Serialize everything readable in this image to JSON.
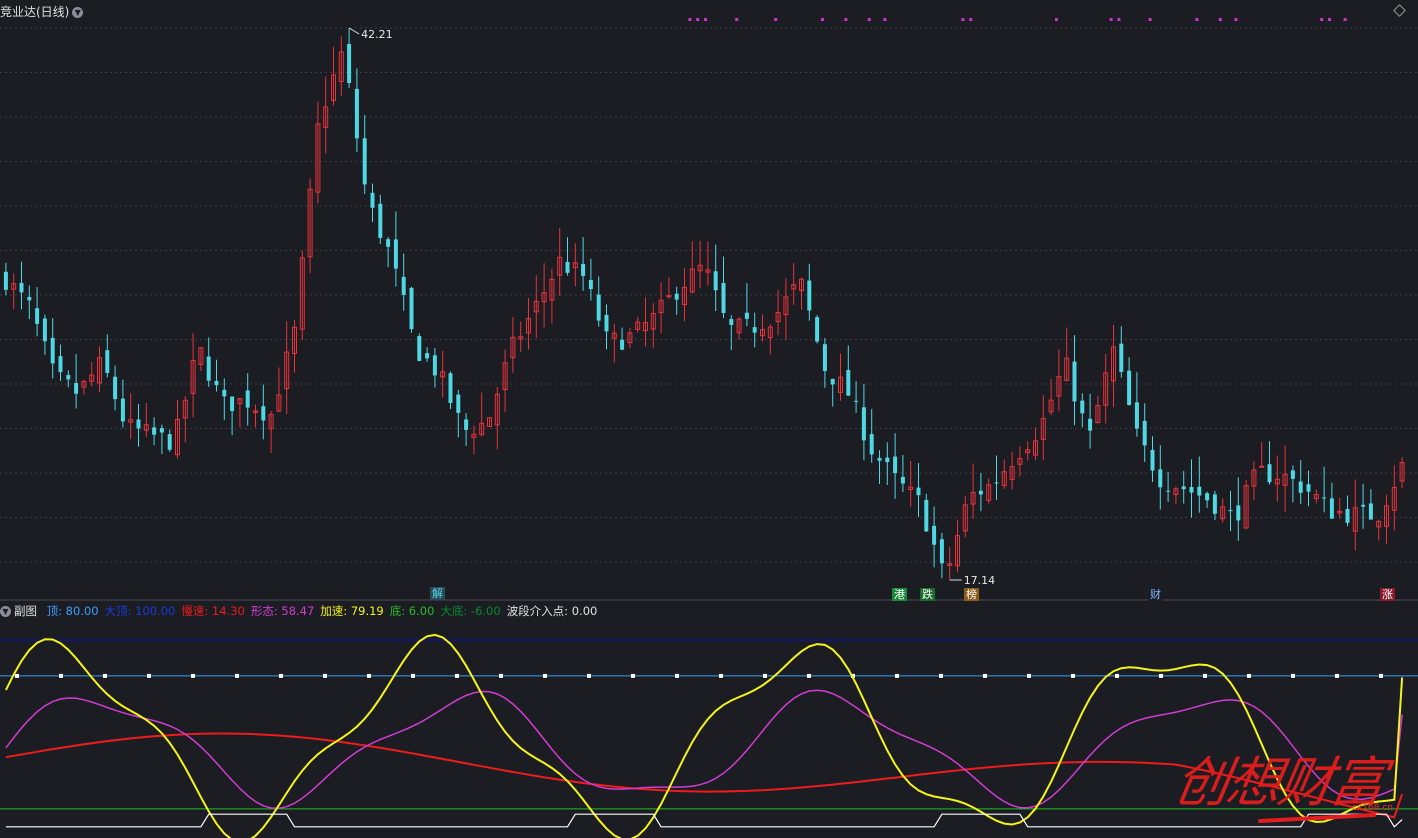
{
  "header": {
    "title": "竞业达(日线)",
    "expand_icon": "chevron-down-icon",
    "settings_icon": "diamond-icon"
  },
  "colors": {
    "bg": "#1b1d23",
    "candle_up": "#e8333a",
    "candle_down": "#4fd8e3",
    "grid": "#3a3d45",
    "top_line": "#3aa0ff",
    "extreme_top": "#1010c8",
    "slow": "#ee1c1c",
    "shape": "#d23cd2",
    "accel": "#f5f519",
    "bottom": "#22c022",
    "extreme_bottom": "#0a8a2a",
    "entry": "#ffffff",
    "marker": "#cc33cc"
  },
  "price_labels": {
    "high": "42.21",
    "low": "17.14"
  },
  "event_tags": [
    {
      "text": "解",
      "color": "#4fd8e3",
      "bg": "#2c4a55"
    },
    {
      "text": "港",
      "color": "#ffffff",
      "bg": "#1a8a3a"
    },
    {
      "text": "跌",
      "color": "#ffffff",
      "bg": "#1a6a2a"
    },
    {
      "text": "榜",
      "color": "#ffffff",
      "bg": "#8a5a1a"
    },
    {
      "text": "财",
      "color": "#7fb8ff",
      "bg": "#1b1d23"
    },
    {
      "text": "涨",
      "color": "#ffffff",
      "bg": "#8a1a2a"
    }
  ],
  "sub_indicator": {
    "name": "副图",
    "items": [
      {
        "label": "顶:",
        "value": "80.00",
        "color": "#3aa0ff"
      },
      {
        "label": "大顶:",
        "value": "100.00",
        "color": "#1a3adc"
      },
      {
        "label": "慢速:",
        "value": "14.30",
        "color": "#ee1c1c"
      },
      {
        "label": "形态:",
        "value": "58.47",
        "color": "#d23cd2"
      },
      {
        "label": "加速:",
        "value": "79.19",
        "color": "#f5f519"
      },
      {
        "label": "底:",
        "value": "6.00",
        "color": "#22c022"
      },
      {
        "label": "大底:",
        "value": "-6.00",
        "color": "#0a8a2a"
      },
      {
        "label": "波段介入点:",
        "value": "0.00",
        "color": "#e0e0e0"
      }
    ]
  },
  "watermark": {
    "text": "创想财富",
    "url": "cx168.cn"
  },
  "chart_data": {
    "type": "candlestick",
    "title": "竞业达(日线)",
    "price_high": 42.21,
    "price_low": 17.14,
    "candle_count": 180,
    "close_path": [
      [
        0,
        30.8
      ],
      [
        4,
        29.5
      ],
      [
        8,
        26.4
      ],
      [
        12,
        25.6
      ],
      [
        16,
        27.0
      ],
      [
        20,
        24.1
      ],
      [
        24,
        23.7
      ],
      [
        28,
        23.4
      ],
      [
        32,
        27.7
      ],
      [
        36,
        25.1
      ],
      [
        40,
        25.3
      ],
      [
        44,
        24.6
      ],
      [
        48,
        28.4
      ],
      [
        52,
        38.0
      ],
      [
        56,
        41.2
      ],
      [
        60,
        34.4
      ],
      [
        64,
        31.8
      ],
      [
        68,
        27.7
      ],
      [
        72,
        26.5
      ],
      [
        76,
        23.9
      ],
      [
        80,
        24.3
      ],
      [
        84,
        27.6
      ],
      [
        88,
        29.5
      ],
      [
        92,
        31.6
      ],
      [
        96,
        30.9
      ],
      [
        100,
        27.9
      ],
      [
        104,
        28.2
      ],
      [
        108,
        29.1
      ],
      [
        112,
        30.5
      ],
      [
        116,
        31.4
      ],
      [
        120,
        28.5
      ],
      [
        124,
        28.6
      ],
      [
        128,
        29.2
      ],
      [
        132,
        30.7
      ],
      [
        136,
        26.8
      ],
      [
        140,
        25.6
      ],
      [
        144,
        23.0
      ],
      [
        148,
        21.6
      ],
      [
        152,
        20.6
      ],
      [
        156,
        17.14
      ],
      [
        160,
        20.9
      ],
      [
        164,
        21.5
      ],
      [
        168,
        22.9
      ],
      [
        172,
        24.1
      ],
      [
        176,
        27.0
      ],
      [
        180,
        23.5
      ],
      [
        184,
        27.6
      ],
      [
        188,
        23.6
      ],
      [
        192,
        21.7
      ],
      [
        196,
        21.3
      ],
      [
        200,
        20.8
      ],
      [
        204,
        19.9
      ],
      [
        208,
        22.0
      ],
      [
        212,
        21.9
      ],
      [
        216,
        21.3
      ],
      [
        220,
        20.3
      ],
      [
        224,
        20.1
      ],
      [
        228,
        20.1
      ],
      [
        232,
        22.3
      ]
    ],
    "sub": {
      "ylim": [
        -8,
        110
      ],
      "top": 80,
      "extreme_top": 100,
      "bottom": 6,
      "extreme_bottom": -6,
      "last": {
        "slow": 14.3,
        "shape": 58.47,
        "accel": 79.19,
        "entry": 0.0
      }
    }
  }
}
